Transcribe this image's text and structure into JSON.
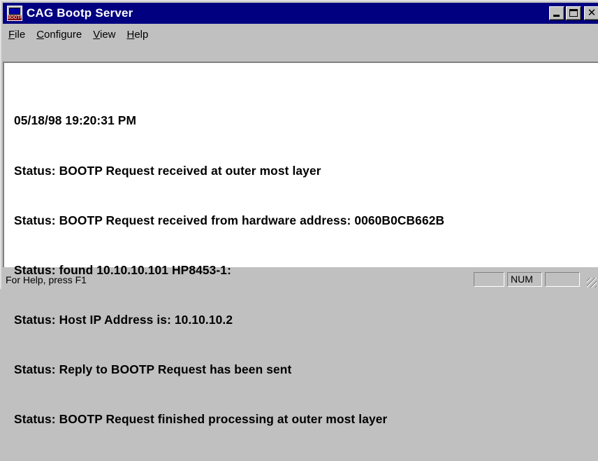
{
  "window": {
    "title": "CAG Bootp Server",
    "icon": "bootp-app-icon",
    "icon_label": "BOOTP"
  },
  "menu": [
    {
      "label": "File",
      "accel": "F",
      "rest": "ile"
    },
    {
      "label": "Configure",
      "accel": "C",
      "rest": "onfigure"
    },
    {
      "label": "View",
      "accel": "V",
      "rest": "iew"
    },
    {
      "label": "Help",
      "accel": "H",
      "rest": "elp"
    }
  ],
  "log": {
    "lines": [
      "05/18/98 19:20:31 PM",
      "Status: BOOTP Request received at outer most layer",
      "Status: BOOTP Request received from hardware address: 0060B0CB662B",
      "Status: found 10.10.10.101 HP8453-1:",
      "Status: Host IP Address is: 10.10.10.2",
      "Status: Reply to BOOTP Request has been sent",
      "Status: BOOTP Request finished processing at outer most layer"
    ]
  },
  "statusbar": {
    "help_text": "For Help, press F1",
    "caps": "",
    "num": "NUM",
    "scrl": ""
  },
  "colors": {
    "titlebar": "#000080",
    "face": "#c0c0c0",
    "client": "#ffffff"
  }
}
